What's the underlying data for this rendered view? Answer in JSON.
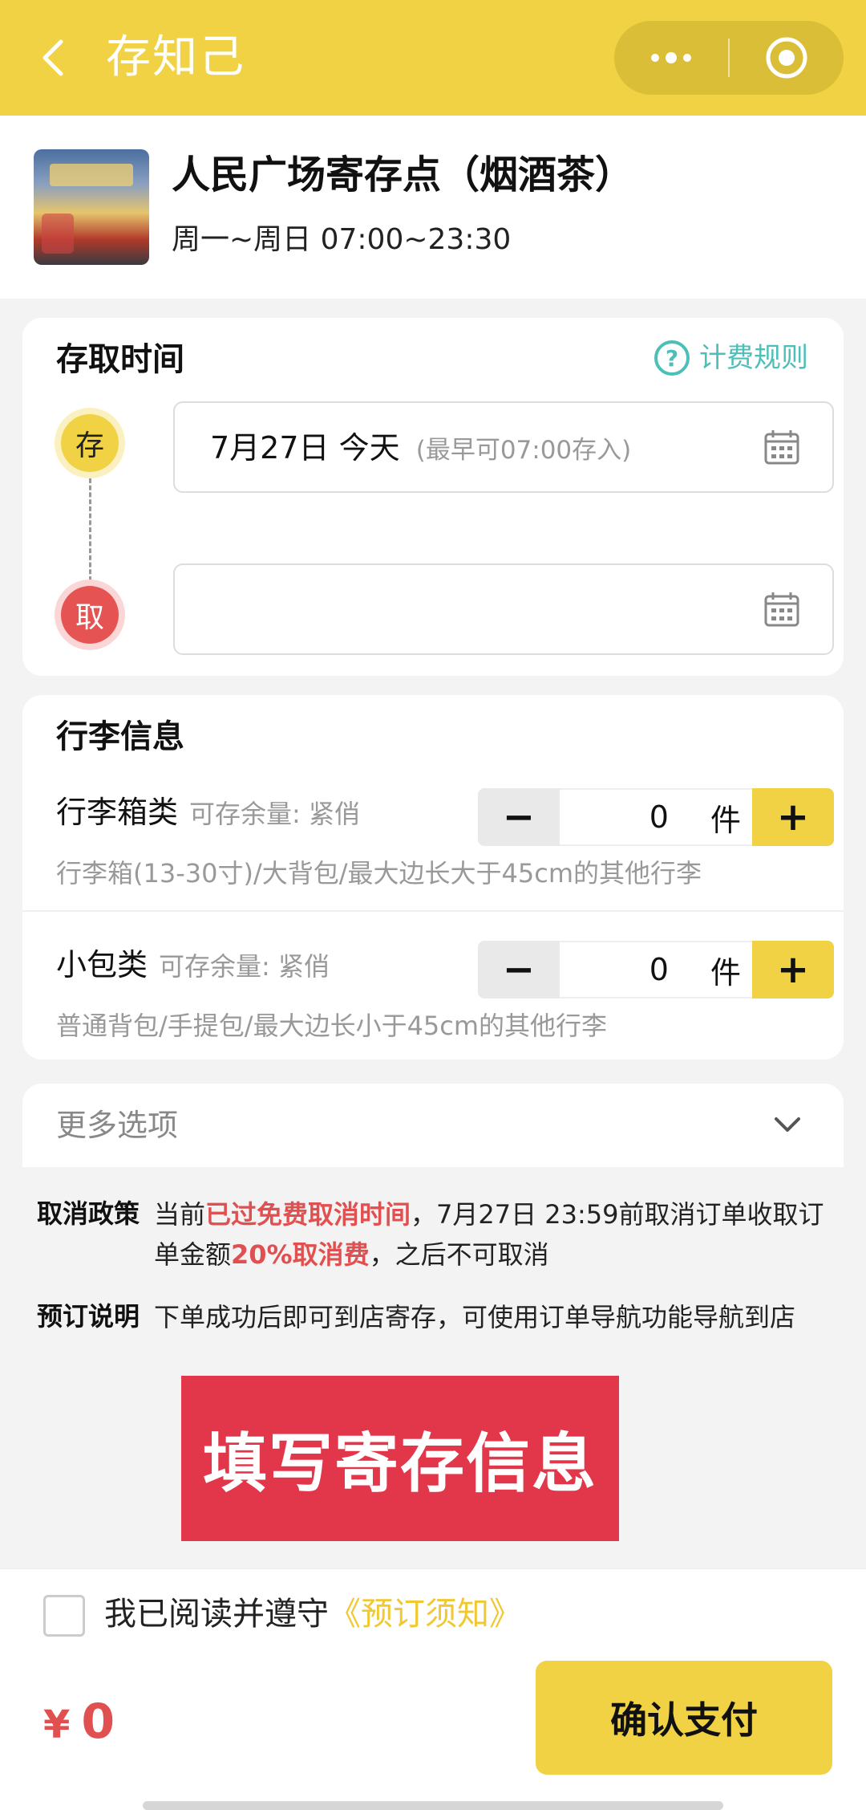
{
  "window": {
    "title": "存知己"
  },
  "colors": {
    "accent": "#f1d244",
    "danger": "#e05050",
    "link": "#4cc0b8",
    "banner": "#e2364a"
  },
  "icons": {
    "back": "chevron-left-icon",
    "menu": "more-dots-icon",
    "close": "target-circle-icon",
    "calendar": "calendar-icon",
    "help": "question-circle-icon",
    "expand": "chevron-down-icon"
  },
  "store": {
    "name": "人民广场寄存点（烟酒茶）",
    "hours": "周一~周日 07:00~23:30"
  },
  "time_section": {
    "title": "存取时间",
    "fee_rule": "计费规则",
    "help_glyph": "?",
    "deposit_badge": "存",
    "pickup_badge": "取",
    "deposit_date": "7月27日 今天",
    "deposit_hint": "(最早可07:00存入)",
    "pickup_date": ""
  },
  "luggage": {
    "title": "行李信息",
    "items": [
      {
        "name": "行李箱类",
        "remain": "可存余量: 紧俏",
        "qty": "0",
        "unit": "件",
        "desc": "行李箱(13-30寸)/大背包/最大边长大于45cm的其他行李"
      },
      {
        "name": "小包类",
        "remain": "可存余量: 紧俏",
        "qty": "0",
        "unit": "件",
        "desc": "普通背包/手提包/最大边长小于45cm的其他行李"
      }
    ],
    "minus": "−",
    "plus": "+"
  },
  "more": {
    "label": "更多选项"
  },
  "policy": {
    "cancel_label": "取消政策",
    "cancel_p1": "当前",
    "cancel_red1": "已过免费取消时间",
    "cancel_p2": "，7月27日 23:59前取消订单收取订单金额",
    "cancel_red2": "20%取消费",
    "cancel_p3": "，之后不可取消",
    "booking_label": "预订说明",
    "booking_text": "下单成功后即可到店寄存，可使用订单导航功能导航到店"
  },
  "banner": {
    "text": "填写寄存信息"
  },
  "footer": {
    "agree_text": "我已阅读并遵守",
    "agree_link": "《预订须知》",
    "currency": "¥",
    "price": "0",
    "pay_button": "确认支付"
  }
}
